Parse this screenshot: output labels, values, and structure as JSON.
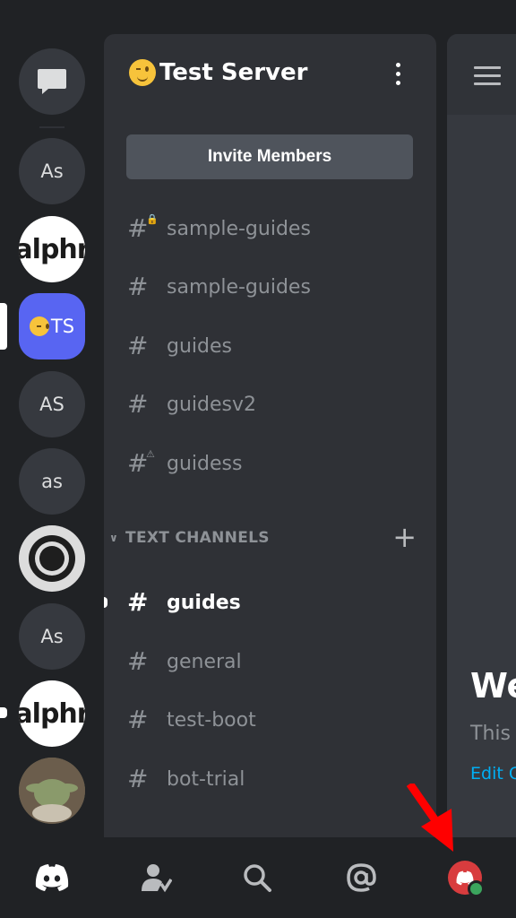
{
  "rail": {
    "servers": [
      {
        "label": "",
        "kind": "dm"
      },
      {
        "label": "As"
      },
      {
        "label": "alphr"
      },
      {
        "label": "TS",
        "active": true
      },
      {
        "label": "AS"
      },
      {
        "label": "as"
      },
      {
        "label": ""
      },
      {
        "label": "As"
      },
      {
        "label": "alphr"
      },
      {
        "label": ""
      }
    ]
  },
  "panel": {
    "server_name": "Test Server",
    "invite_label": "Invite Members",
    "top_channels": [
      "sample-guides",
      "sample-guides",
      "guides",
      "guidesv2",
      "guidess"
    ],
    "category": "TEXT CHANNELS",
    "text_channels": [
      "guides",
      "general",
      "test-boot",
      "bot-trial"
    ]
  },
  "chat": {
    "welcome": "We",
    "this_is": "This",
    "edit": "Edit C"
  },
  "colors": {
    "accent": "#5865f2",
    "annotation_arrow": "#ff0000",
    "online": "#3ba55d"
  }
}
